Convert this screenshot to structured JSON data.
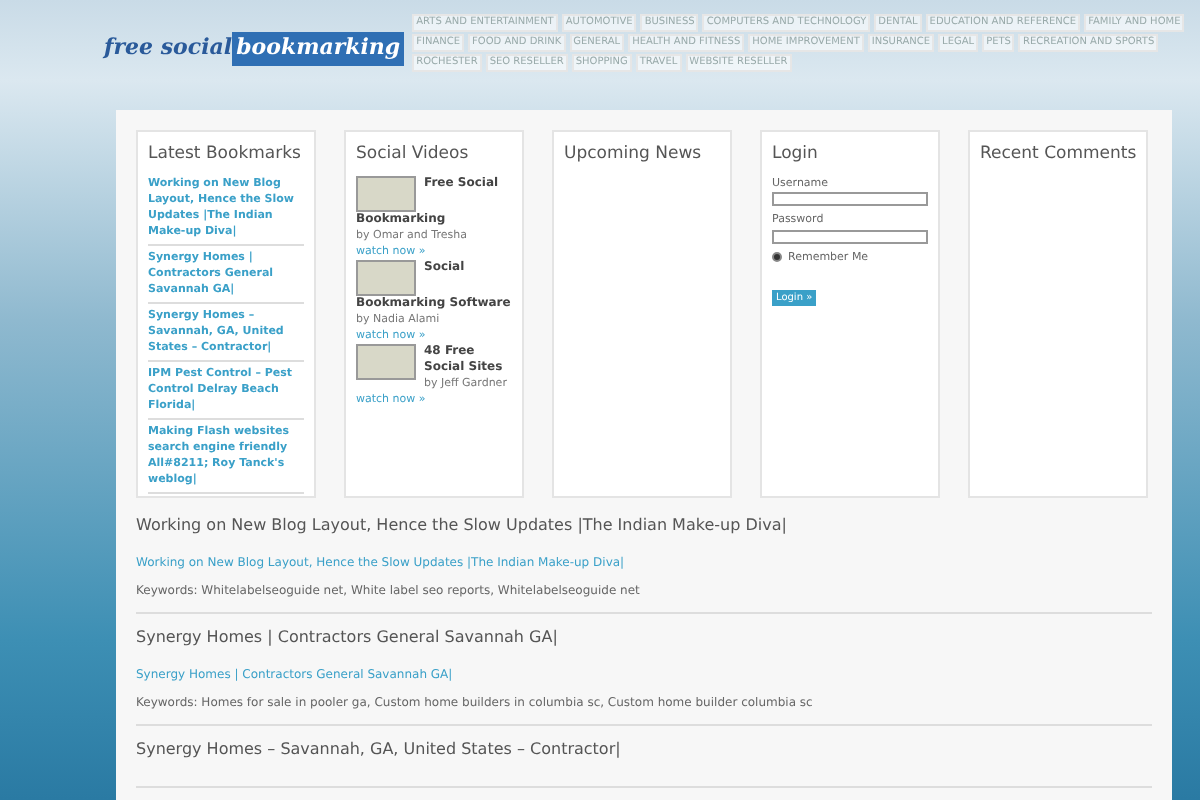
{
  "logo": {
    "part_1": "free social",
    "part_2": "bookmarking"
  },
  "categories": [
    "ARTS AND ENTERTAINMENT",
    "AUTOMOTIVE",
    "BUSINESS",
    "COMPUTERS AND TECHNOLOGY",
    "DENTAL",
    "EDUCATION AND REFERENCE",
    "FAMILY AND HOME",
    "FINANCE",
    "FOOD AND DRINK",
    "GENERAL",
    "HEALTH AND FITNESS",
    "HOME IMPROVEMENT",
    "INSURANCE",
    "LEGAL",
    "PETS",
    "RECREATION AND SPORTS",
    "ROCHESTER",
    "SEO RESELLER",
    "SHOPPING",
    "TRAVEL",
    "WEBSITE RESELLER"
  ],
  "latest_bookmarks": {
    "title": "Latest Bookmarks",
    "items": [
      "Working on New Blog Layout, Hence the Slow Updates |The Indian Make-up Diva|",
      "Synergy Homes | Contractors General Savannah GA|",
      "Synergy Homes – Savannah, GA, United States – Contractor|",
      "IPM Pest Control – Pest Control Delray Beach Florida|",
      "Making Flash websites search engine friendly All#8211; Roy Tanck's weblog|"
    ]
  },
  "social_videos": {
    "title": "Social Videos",
    "items": [
      {
        "title": "Free Social Bookmarking",
        "author": "by Omar and Tresha",
        "link": "watch now »"
      },
      {
        "title": "Social Bookmarking Software",
        "author": "by Nadia Alami",
        "link": "watch now »"
      },
      {
        "title": "48 Free Social Sites",
        "author": "by Jeff Gardner",
        "link": "watch now »"
      }
    ]
  },
  "upcoming_news": {
    "title": "Upcoming News"
  },
  "login": {
    "title": "Login",
    "username_label": "Username",
    "password_label": "Password",
    "remember_label": "Remember Me",
    "remember_checked": true,
    "button": "Login »"
  },
  "recent_comments": {
    "title": "Recent Comments"
  },
  "posts": [
    {
      "title": "Working on New Blog Layout, Hence the Slow Updates |The Indian Make-up Diva|",
      "link": "Working on New Blog Layout, Hence the Slow Updates |The Indian Make-up Diva|",
      "keywords": "Keywords: Whitelabelseoguide net, White label seo reports, Whitelabelseoguide net"
    },
    {
      "title": "Synergy Homes | Contractors General Savannah GA|",
      "link": "Synergy Homes | Contractors General Savannah GA|",
      "keywords": "Keywords: Homes for sale in pooler ga, Custom home builders in columbia sc, Custom home builder columbia sc"
    },
    {
      "title": "Synergy Homes – Savannah, GA, United States – Contractor|"
    }
  ]
}
